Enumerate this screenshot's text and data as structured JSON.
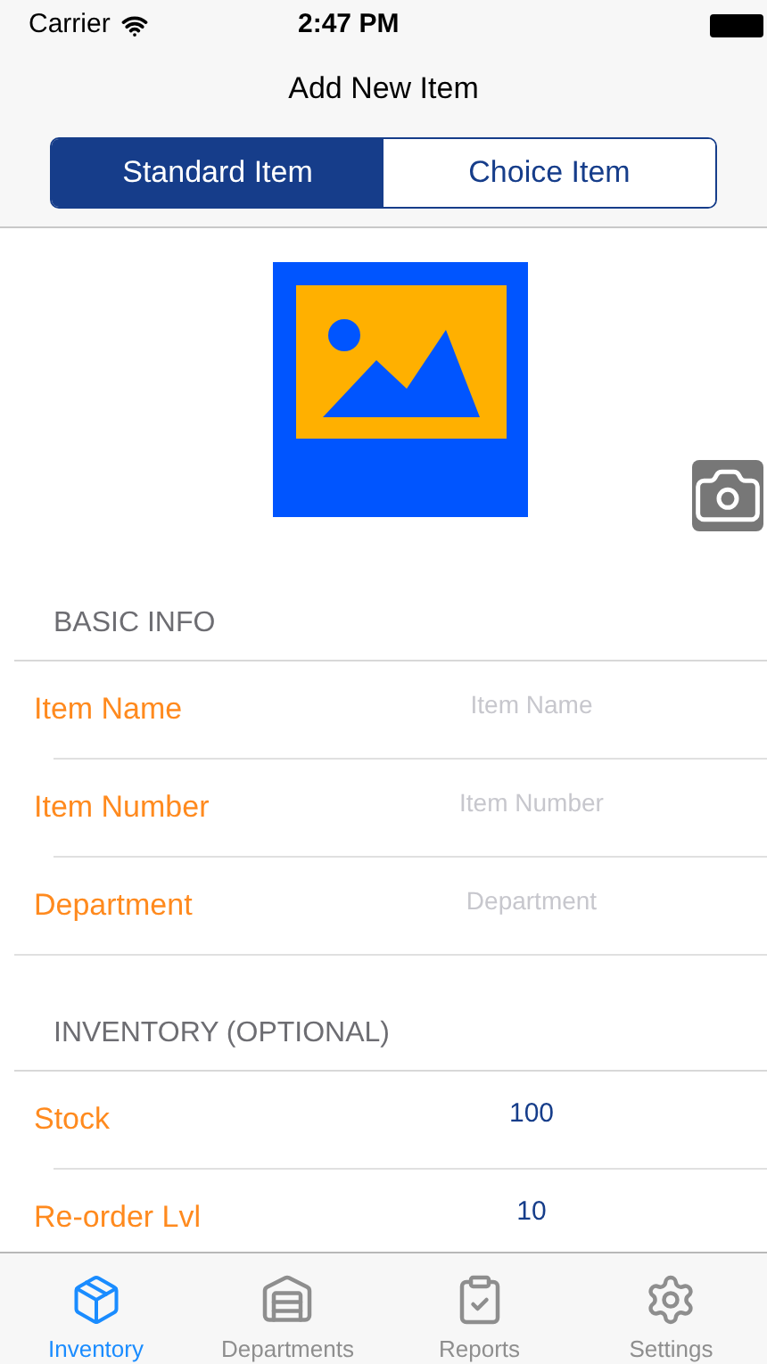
{
  "status_bar": {
    "carrier": "Carrier",
    "time": "2:47 PM"
  },
  "nav": {
    "title": "Add New Item"
  },
  "segments": [
    {
      "label": "Standard Item",
      "selected": true
    },
    {
      "label": "Choice Item",
      "selected": false
    }
  ],
  "sections": [
    {
      "header": "BASIC INFO",
      "rows": [
        {
          "label": "Item Name",
          "placeholder": "Item Name"
        },
        {
          "label": "Item Number",
          "placeholder": "Item Number"
        },
        {
          "label": "Department",
          "placeholder": "Department"
        }
      ]
    },
    {
      "header": "INVENTORY (OPTIONAL)",
      "rows": [
        {
          "label": "Stock",
          "value": "100"
        },
        {
          "label": "Re-order Lvl",
          "value": "10"
        }
      ]
    }
  ],
  "tab_bar": [
    {
      "label": "Inventory",
      "kind": "box",
      "selected": true
    },
    {
      "label": "Departments",
      "kind": "garage",
      "selected": false
    },
    {
      "label": "Reports",
      "kind": "clipboard",
      "selected": false
    },
    {
      "label": "Settings",
      "kind": "gear",
      "selected": false
    }
  ]
}
